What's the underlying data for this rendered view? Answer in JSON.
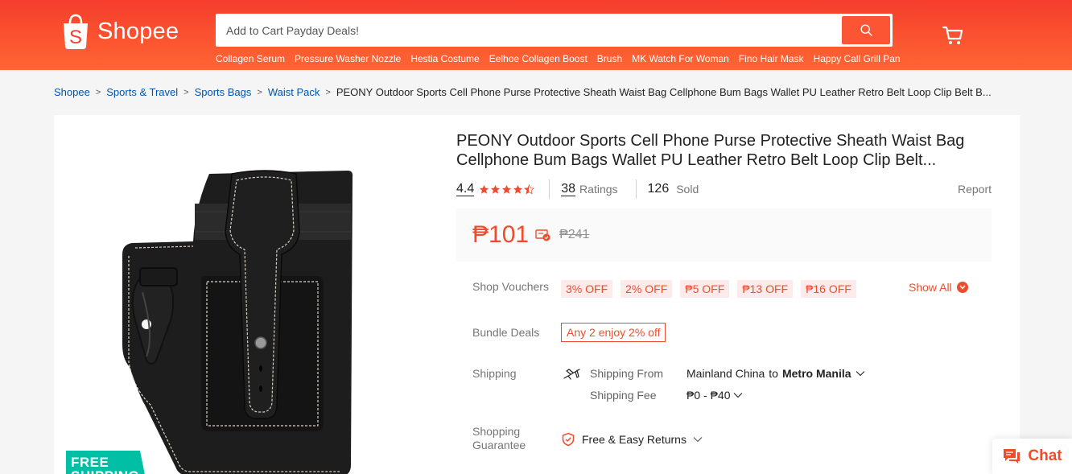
{
  "header": {
    "logo_text": "Shopee",
    "search_placeholder": "Add to Cart Payday Deals!",
    "suggestions": [
      "Collagen Serum",
      "Pressure Washer Nozzle",
      "Hestia Costume",
      "Eelhoe Collagen Boost",
      "Brush",
      "MK Watch For Woman",
      "Fino Hair Mask",
      "Happy Call Grill Pan"
    ],
    "brand_color": "#f53d2d"
  },
  "breadcrumb": {
    "items": [
      "Shopee",
      "Sports & Travel",
      "Sports Bags",
      "Waist Pack"
    ],
    "current": "PEONY Outdoor Sports Cell Phone Purse Protective Sheath Waist Bag Cellphone Bum Bags Wallet PU Leather Retro Belt Loop Clip Belt B..."
  },
  "product": {
    "title": "PEONY Outdoor Sports Cell Phone Purse Protective Sheath Waist Bag Cellphone Bum Bags Wallet PU Leather Retro Belt Loop Clip Belt...",
    "rating": "4.4",
    "stars": 4.4,
    "ratings_count": "38",
    "ratings_label": "Ratings",
    "sold_count": "126",
    "sold_label": "Sold",
    "report_label": "Report",
    "price": "₱101",
    "original_price": "₱241",
    "badge_text": "FREE SHIPPING",
    "accent_color": "#ee4d2d"
  },
  "vouchers": {
    "label": "Shop Vouchers",
    "items": [
      "3% OFF",
      "2% OFF",
      "₱5 OFF",
      "₱13 OFF",
      "₱16 OFF"
    ],
    "show_all": "Show All"
  },
  "bundle": {
    "label": "Bundle Deals",
    "tag": "Any 2 enjoy 2% off"
  },
  "shipping": {
    "label": "Shipping",
    "from_label": "Shipping From",
    "from_value": "Mainland China",
    "to_word": "to",
    "destination": "Metro Manila",
    "fee_label": "Shipping Fee",
    "fee_value": "₱0 - ₱40"
  },
  "guarantee": {
    "label": "Shopping Guarantee",
    "value": "Free & Easy Returns"
  },
  "chat": {
    "label": "Chat"
  }
}
